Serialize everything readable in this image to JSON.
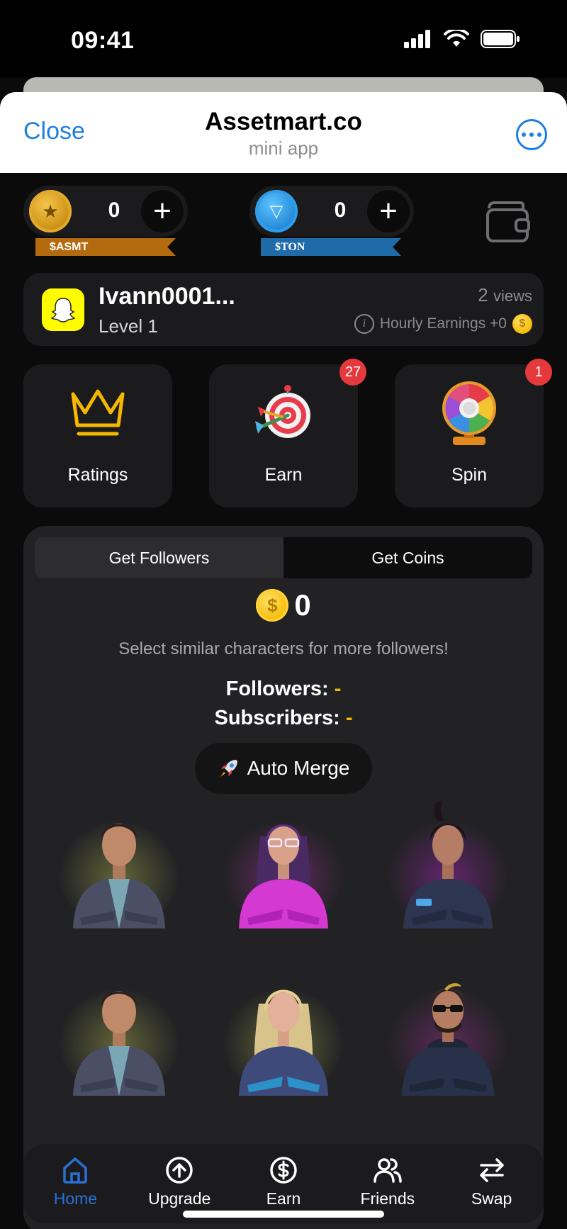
{
  "status_bar": {
    "time": "09:41"
  },
  "header": {
    "close_label": "Close",
    "title": "Assetmart.co",
    "subtitle": "mini app"
  },
  "balances": {
    "asmt": {
      "value": "0",
      "ticker": "$ASMT",
      "color": "#c88d12"
    },
    "ton": {
      "value": "0",
      "ticker": "$TON",
      "color": "#1f87d6"
    }
  },
  "profile": {
    "name": "Ivann0001...",
    "level": "Level 1",
    "views_count": "2",
    "views_label": "views",
    "hourly_label": "Hourly Earnings +0"
  },
  "tiles": [
    {
      "label": "Ratings",
      "icon": "crown-icon",
      "badge": ""
    },
    {
      "label": "Earn",
      "icon": "target-dart-icon",
      "badge": "27"
    },
    {
      "label": "Spin",
      "icon": "prize-wheel-icon",
      "badge": "1"
    }
  ],
  "game": {
    "tabs": [
      "Get Followers",
      "Get Coins"
    ],
    "active_tab": "Get Followers",
    "score": "0",
    "hint": "Select similar characters for more followers!",
    "followers_label": "Followers:",
    "followers_value": "-",
    "subscribers_label": "Subscribers:",
    "subscribers_value": "-",
    "auto_merge_label": "Auto Merge",
    "characters": [
      {
        "name": "character-man-jacket",
        "glow": "#d7e05a"
      },
      {
        "name": "character-woman-pink",
        "glow": "#e23ad0"
      },
      {
        "name": "character-woman-ponytail",
        "glow": "#c22ad8"
      },
      {
        "name": "character-man-jacket",
        "glow": "#d7e05a"
      },
      {
        "name": "character-woman-blonde",
        "glow": "#d7e05a"
      },
      {
        "name": "character-man-sunglasses",
        "glow": "#e23ad0"
      }
    ]
  },
  "nav": {
    "items": [
      {
        "label": "Home",
        "icon": "home-icon",
        "active": true
      },
      {
        "label": "Upgrade",
        "icon": "arrow-up-circle-icon",
        "active": false
      },
      {
        "label": "Earn",
        "icon": "dollar-circle-icon",
        "active": false
      },
      {
        "label": "Friends",
        "icon": "users-icon",
        "active": false
      },
      {
        "label": "Swap",
        "icon": "swap-arrows-icon",
        "active": false
      }
    ]
  },
  "colors": {
    "accent_blue": "#1f7fe0",
    "nav_active": "#2a6fd6",
    "badge_red": "#e5393d",
    "coin_gold": "#f5b800"
  }
}
